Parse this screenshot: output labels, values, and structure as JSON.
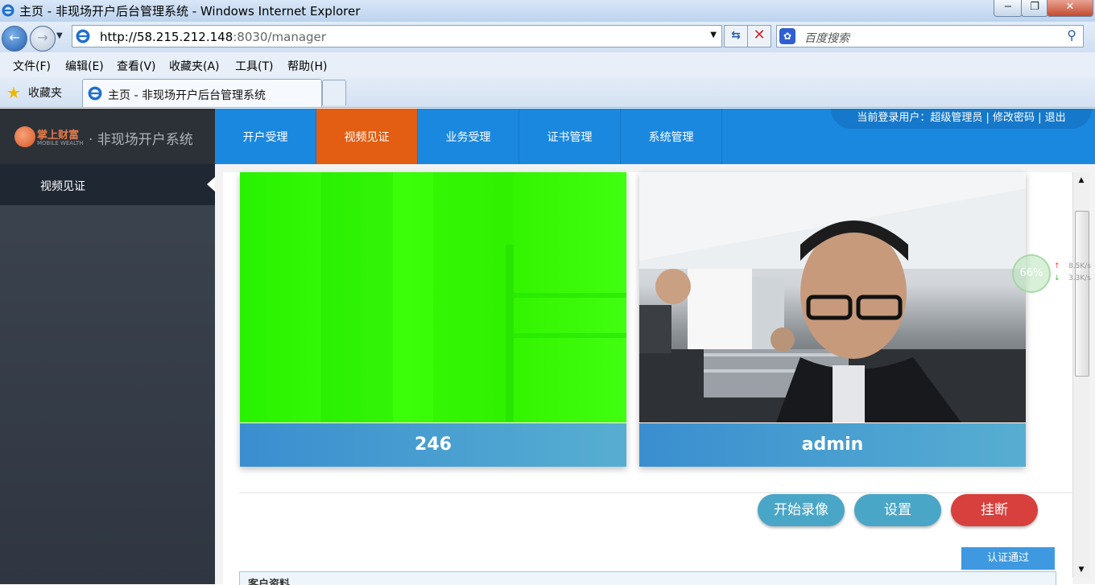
{
  "browser": {
    "window_title": "主页 - 非现场开户后台管理系统 - Windows Internet Explorer",
    "url_host": "http://58.215.212.148",
    "url_rest": ":8030/manager",
    "search_placeholder": "百度搜索",
    "menu": [
      "文件(F)",
      "编辑(E)",
      "查看(V)",
      "收藏夹(A)",
      "工具(T)",
      "帮助(H)"
    ],
    "favorites_label": "收藏夹",
    "tab_title": "主页 - 非现场开户后台管理系统",
    "win_min": "−",
    "win_max": "❐",
    "win_close": "✕"
  },
  "app": {
    "brand_cn": "掌上财富",
    "brand_en": "MOBILE WEALTH",
    "system_name": "· 非现场开户系统",
    "nav": [
      "开户受理",
      "视频见证",
      "业务受理",
      "证书管理",
      "系统管理"
    ],
    "active_nav": "视频见证",
    "user_info": "当前登录用户：超级管理员 | 修改密码 | 退出"
  },
  "sidebar": {
    "items": [
      {
        "label": "视频见证",
        "active": true
      }
    ]
  },
  "videos": [
    {
      "caption": "246"
    },
    {
      "caption": "admin"
    }
  ],
  "actions": {
    "start_record": "开始录像",
    "settings": "设置",
    "hangup": "挂断",
    "verify_pass": "认证通过"
  },
  "customer_section": {
    "title": "客户资料"
  },
  "net_widget": {
    "percent": "66%",
    "up": "8.5K/s",
    "down": "3.3K/s"
  },
  "colors": {
    "header_blue": "#1b88e0",
    "active_orange": "#e35d12",
    "hangup_red": "#d7403d",
    "action_blue": "#4aa6c7"
  }
}
